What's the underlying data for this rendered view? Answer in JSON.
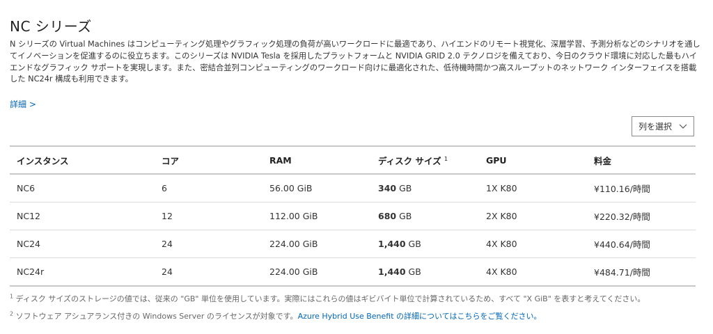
{
  "page": {
    "title": "NC シリーズ",
    "description": "N シリーズの Virtual Machines はコンピューティング処理やグラフィック処理の負荷が高いワークロードに最適であり、ハイエンドのリモート視覚化、深層学習、予測分析などのシナリオを通してイノベーションを促進するのに役立ちます。このシリーズは NVIDIA Tesla を採用したプラットフォームと NVIDIA GRID 2.0 テクノロジを備えており、今日のクラウド環境に対応した最もハイエンドなグラフィック サポートを実現します。また、密結合並列コンピューティングのワークロード向けに最適化された、低待機時間かつ高スループットのネットワーク インターフェイスを搭載した NC24r 構成も利用できます。",
    "more_link": "詳細 >"
  },
  "toolbar": {
    "column_select_label": "列を選択"
  },
  "table": {
    "headers": {
      "instance": "インスタンス",
      "cores": "コア",
      "ram": "RAM",
      "disk": "ディスク サイズ",
      "disk_sup": "1",
      "gpu": "GPU",
      "price": "料金"
    },
    "rows": [
      {
        "instance": "NC6",
        "cores": "6",
        "ram": "56.00 GiB",
        "disk_value": "340",
        "disk_unit": "GB",
        "gpu": "1X K80",
        "price": "¥110.16/時間"
      },
      {
        "instance": "NC12",
        "cores": "12",
        "ram": "112.00 GiB",
        "disk_value": "680",
        "disk_unit": "GB",
        "gpu": "2X K80",
        "price": "¥220.32/時間"
      },
      {
        "instance": "NC24",
        "cores": "24",
        "ram": "224.00 GiB",
        "disk_value": "1,440",
        "disk_unit": "GB",
        "gpu": "4X K80",
        "price": "¥440.64/時間"
      },
      {
        "instance": "NC24r",
        "cores": "24",
        "ram": "224.00 GiB",
        "disk_value": "1,440",
        "disk_unit": "GB",
        "gpu": "4X K80",
        "price": "¥484.71/時間"
      }
    ]
  },
  "footnotes": {
    "fn1_mark": "1",
    "fn1_text": "ディスク サイズのストレージの値では、従来の \"GB\" 単位を使用しています。実際にはこれらの値はギビバイト単位で計算されているため、すべて \"X GiB\" を表すと考えてください。",
    "fn2_mark": "2",
    "fn2_text": "ソフトウェア アシュアランス付きの Windows Server のライセンスが対象です。",
    "fn2_link": "Azure Hybrid Use Benefit の詳細についてはこちらをご覧ください。"
  },
  "colors": {
    "link": "#0066b8",
    "text": "#333333",
    "border": "#c8c8c8"
  },
  "icons": {
    "column_select": "chevron-down-icon"
  }
}
